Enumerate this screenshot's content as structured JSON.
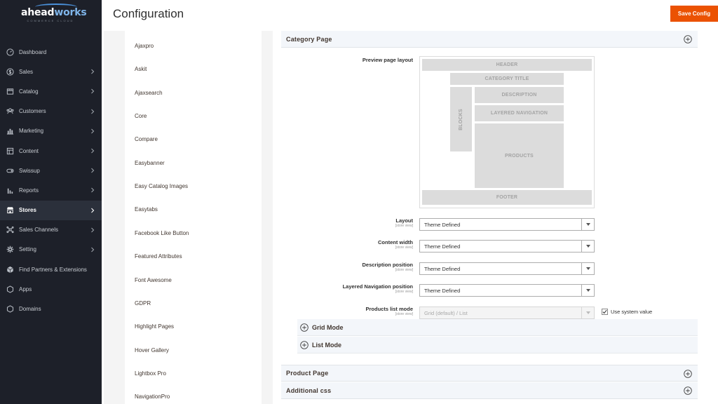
{
  "app": {
    "logo_text_main": "ahead",
    "logo_text_accent": "works",
    "logo_subtext": "COMMERCE CLOUD"
  },
  "header": {
    "title": "Configuration",
    "save_label": "Save Config"
  },
  "sidebar": {
    "items": [
      {
        "label": "Dashboard",
        "icon": "dashboard-icon",
        "chevron": false,
        "active": false
      },
      {
        "label": "Sales",
        "icon": "dollar-icon",
        "chevron": true,
        "active": false
      },
      {
        "label": "Catalog",
        "icon": "box-icon",
        "chevron": true,
        "active": false
      },
      {
        "label": "Customers",
        "icon": "users-icon",
        "chevron": true,
        "active": false
      },
      {
        "label": "Marketing",
        "icon": "bar-chart-icon",
        "chevron": true,
        "active": false
      },
      {
        "label": "Content",
        "icon": "layout-icon",
        "chevron": true,
        "active": false
      },
      {
        "label": "Swissup",
        "icon": "toggle-icon",
        "chevron": true,
        "active": false
      },
      {
        "label": "Reports",
        "icon": "reports-icon",
        "chevron": true,
        "active": false
      },
      {
        "label": "Stores",
        "icon": "store-icon",
        "chevron": true,
        "active": true
      },
      {
        "label": "Sales Channels",
        "icon": "channels-icon",
        "chevron": true,
        "active": false
      },
      {
        "label": "Setting",
        "icon": "gear-icon",
        "chevron": true,
        "active": false
      },
      {
        "label": "Find Partners & Extensions",
        "icon": "cube-icon",
        "chevron": false,
        "active": false
      },
      {
        "label": "Apps",
        "icon": "hexagon-icon",
        "chevron": false,
        "active": false
      },
      {
        "label": "Domains",
        "icon": "hexagon-icon",
        "chevron": false,
        "active": false
      }
    ]
  },
  "tabs": [
    "Ajaxpro",
    "Askit",
    "Ajaxsearch",
    "Core",
    "Compare",
    "Easybanner",
    "Easy Catalog Images",
    "Easytabs",
    "Facebook Like Button",
    "Featured Attributes",
    "Font Awesome",
    "GDPR",
    "Highlight Pages",
    "Hover Gallery",
    "Lightbox Pro",
    "NavigationPro"
  ],
  "category_page": {
    "title": "Category Page",
    "preview_label": "Preview page layout",
    "preview": {
      "header": "HEADER",
      "category_title": "CATEGORY TITLE",
      "blocks": "BLOCKS",
      "description": "DESCRIPTION",
      "layered_navigation": "LAYERED NAVIGATION",
      "products": "PRODUCTS",
      "footer": "FOOTER"
    },
    "fields": [
      {
        "label": "Layout",
        "scope": "[store view]",
        "value": "Theme Defined",
        "disabled": false
      },
      {
        "label": "Content width",
        "scope": "[store view]",
        "value": "Theme Defined",
        "disabled": false
      },
      {
        "label": "Description position",
        "scope": "[store view]",
        "value": "Theme Defined",
        "disabled": false
      },
      {
        "label": "Layered Navigation position",
        "scope": "[store view]",
        "value": "Theme Defined",
        "disabled": false
      },
      {
        "label": "Products list mode",
        "scope": "[store view]",
        "value": "Grid (default) / List",
        "disabled": true
      }
    ],
    "use_system_value_label": "Use system value",
    "use_system_value_checked": true,
    "subsections": [
      "Grid Mode",
      "List Mode"
    ]
  },
  "sections": [
    "Product Page",
    "Additional css"
  ],
  "colors": {
    "sidebar_bg": "#1d2029",
    "accent_orange": "#eb5202",
    "section_bg": "#f3f6fa"
  }
}
